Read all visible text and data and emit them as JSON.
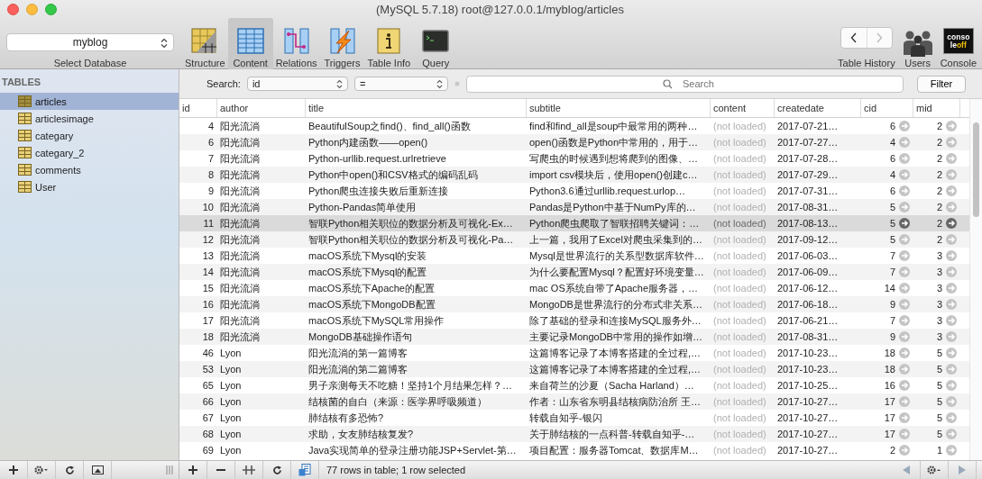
{
  "window": {
    "title": "(MySQL 5.7.18) root@127.0.0.1/myblog/articles"
  },
  "toolbar": {
    "database": {
      "value": "myblog",
      "label": "Select Database"
    },
    "tabs": [
      {
        "label": "Structure",
        "kind": "structure",
        "selected": false
      },
      {
        "label": "Content",
        "kind": "content",
        "selected": true
      },
      {
        "label": "Relations",
        "kind": "relations",
        "selected": false
      },
      {
        "label": "Triggers",
        "kind": "triggers",
        "selected": false
      },
      {
        "label": "Table Info",
        "kind": "info",
        "selected": false
      },
      {
        "label": "Query",
        "kind": "query",
        "selected": false
      }
    ],
    "history": {
      "label": "Table History"
    },
    "users": {
      "label": "Users"
    },
    "console": {
      "label": "Console",
      "badge_top": "conso",
      "badge_bottom_left": "le",
      "badge_bottom_right": "off"
    }
  },
  "sidebar": {
    "heading": "TABLES",
    "items": [
      {
        "name": "articles",
        "selected": true
      },
      {
        "name": "articlesimage",
        "selected": false
      },
      {
        "name": "categary",
        "selected": false
      },
      {
        "name": "categary_2",
        "selected": false
      },
      {
        "name": "comments",
        "selected": false
      },
      {
        "name": "User",
        "selected": false
      }
    ]
  },
  "search": {
    "label": "Search:",
    "field": "id",
    "operator": "=",
    "placeholder": "Search",
    "button": "Filter"
  },
  "table": {
    "columns": [
      "id",
      "author",
      "title",
      "subtitle",
      "content",
      "createdate",
      "cid",
      "mid"
    ],
    "rows": [
      {
        "id": "4",
        "author": "阳光流淌",
        "title": "BeautifulSoup之find()、find_all()函数",
        "subtitle": "find和find_all是soup中最常用的两种…",
        "content": "(not loaded)",
        "createdate": "2017-07-21…",
        "cid": "6",
        "mid": "2",
        "selected": false
      },
      {
        "id": "6",
        "author": "阳光流淌",
        "title": "Python内建函数——open()",
        "subtitle": "open()函数是Python中常用的，用于…",
        "content": "(not loaded)",
        "createdate": "2017-07-27…",
        "cid": "4",
        "mid": "2",
        "selected": false
      },
      {
        "id": "7",
        "author": "阳光流淌",
        "title": "Python-urllib.request.urlretrieve",
        "subtitle": "写爬虫的时候遇到想将爬到的图像、…",
        "content": "(not loaded)",
        "createdate": "2017-07-28…",
        "cid": "6",
        "mid": "2",
        "selected": false
      },
      {
        "id": "8",
        "author": "阳光流淌",
        "title": "Python中open()和CSV格式的编码乱码",
        "subtitle": "import csv模块后，使用open()创建c…",
        "content": "(not loaded)",
        "createdate": "2017-07-29…",
        "cid": "4",
        "mid": "2",
        "selected": false
      },
      {
        "id": "9",
        "author": "阳光流淌",
        "title": "Python爬虫连接失败后重新连接",
        "subtitle": "Python3.6通过urllib.request.urlop…",
        "content": "(not loaded)",
        "createdate": "2017-07-31…",
        "cid": "6",
        "mid": "2",
        "selected": false
      },
      {
        "id": "10",
        "author": "阳光流淌",
        "title": "Python-Pandas简单使用",
        "subtitle": "Pandas是Python中基于NumPy库的…",
        "content": "(not loaded)",
        "createdate": "2017-08-31…",
        "cid": "5",
        "mid": "2",
        "selected": false
      },
      {
        "id": "11",
        "author": "阳光流淌",
        "title": "智联Python相关职位的数据分析及可视化-Ex…",
        "subtitle": "Python爬虫爬取了智联招聘关键词：…",
        "content": "(not loaded)",
        "createdate": "2017-08-13…",
        "cid": "5",
        "mid": "2",
        "selected": true
      },
      {
        "id": "12",
        "author": "阳光流淌",
        "title": "智联Python相关职位的数据分析及可视化-Pa…",
        "subtitle": "上一篇，我用了Excel对爬虫采集到的…",
        "content": "(not loaded)",
        "createdate": "2017-09-12…",
        "cid": "5",
        "mid": "2",
        "selected": false
      },
      {
        "id": "13",
        "author": "阳光流淌",
        "title": "macOS系统下Mysql的安装",
        "subtitle": "Mysql是世界流行的关系型数据库软件…",
        "content": "(not loaded)",
        "createdate": "2017-06-03…",
        "cid": "7",
        "mid": "3",
        "selected": false
      },
      {
        "id": "14",
        "author": "阳光流淌",
        "title": "macOS系统下Mysql的配置",
        "subtitle": "为什么要配置Mysql？配置好环境变量…",
        "content": "(not loaded)",
        "createdate": "2017-06-09…",
        "cid": "7",
        "mid": "3",
        "selected": false
      },
      {
        "id": "15",
        "author": "阳光流淌",
        "title": "macOS系统下Apache的配置",
        "subtitle": "mac OS系统自带了Apache服务器，…",
        "content": "(not loaded)",
        "createdate": "2017-06-12…",
        "cid": "14",
        "mid": "3",
        "selected": false
      },
      {
        "id": "16",
        "author": "阳光流淌",
        "title": "macOS系统下MongoDB配置",
        "subtitle": "MongoDB是世界流行的分布式非关系…",
        "content": "(not loaded)",
        "createdate": "2017-06-18…",
        "cid": "9",
        "mid": "3",
        "selected": false
      },
      {
        "id": "17",
        "author": "阳光流淌",
        "title": "macOS系统下MySQL常用操作",
        "subtitle": "除了基础的登录和连接MySQL服务外…",
        "content": "(not loaded)",
        "createdate": "2017-06-21…",
        "cid": "7",
        "mid": "3",
        "selected": false
      },
      {
        "id": "18",
        "author": "阳光流淌",
        "title": "MongoDB基础操作语句",
        "subtitle": "主要记录MongoDB中常用的操作如增…",
        "content": "(not loaded)",
        "createdate": "2017-08-31…",
        "cid": "9",
        "mid": "3",
        "selected": false
      },
      {
        "id": "46",
        "author": "Lyon",
        "title": "阳光流淌的第一篇博客",
        "subtitle": "这篇博客记录了本博客搭建的全过程,…",
        "content": "(not loaded)",
        "createdate": "2017-10-23…",
        "cid": "18",
        "mid": "5",
        "selected": false
      },
      {
        "id": "53",
        "author": "Lyon",
        "title": "阳光流淌的第二篇博客",
        "subtitle": "这篇博客记录了本博客搭建的全过程,…",
        "content": "(not loaded)",
        "createdate": "2017-10-23…",
        "cid": "18",
        "mid": "5",
        "selected": false
      },
      {
        "id": "65",
        "author": "Lyon",
        "title": "男子亲测每天不吃糖！坚持1个月结果怎样？…",
        "subtitle": "来自荷兰的沙夏（Sacha Harland）…",
        "content": "(not loaded)",
        "createdate": "2017-10-25…",
        "cid": "16",
        "mid": "5",
        "selected": false
      },
      {
        "id": "66",
        "author": "Lyon",
        "title": "结核菌的自白（来源：医学界呼吸频道）",
        "subtitle": "作者：山东省东明县结核病防治所 王…",
        "content": "(not loaded)",
        "createdate": "2017-10-27…",
        "cid": "17",
        "mid": "5",
        "selected": false
      },
      {
        "id": "67",
        "author": "Lyon",
        "title": "肺结核有多恐怖?",
        "subtitle": "转载自知乎-银闪",
        "content": "(not loaded)",
        "createdate": "2017-10-27…",
        "cid": "17",
        "mid": "5",
        "selected": false
      },
      {
        "id": "68",
        "author": "Lyon",
        "title": "求助，女友肺结核复发?",
        "subtitle": "关于肺结核的一点科普-转载自知乎-…",
        "content": "(not loaded)",
        "createdate": "2017-10-27…",
        "cid": "17",
        "mid": "5",
        "selected": false
      },
      {
        "id": "69",
        "author": "Lyon",
        "title": "Java实现简单的登录注册功能JSP+Servlet-第…",
        "subtitle": "项目配置：服务器Tomcat、数据库M…",
        "content": "(not loaded)",
        "createdate": "2017-10-27…",
        "cid": "2",
        "mid": "1",
        "selected": false
      }
    ]
  },
  "status_bar": {
    "text": "77 rows in table; 1 row selected"
  }
}
